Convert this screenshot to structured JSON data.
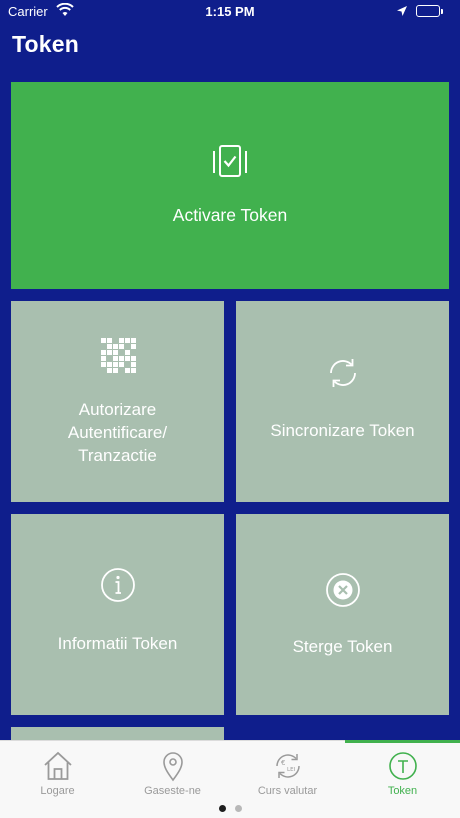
{
  "status_bar": {
    "carrier": "Carrier",
    "time": "1:15 PM",
    "battery_color": "#4cd964"
  },
  "page": {
    "title": "Token",
    "background": "#0f1e8c"
  },
  "tiles": {
    "activate": {
      "label": "Activare Token",
      "icon": "token-check-icon",
      "color": "#41b14e"
    },
    "authorize": {
      "line1": "Autorizare",
      "line2": "Autentificare/",
      "line3": "Tranzactie",
      "icon": "grid-pattern-icon",
      "color": "#a9bfaf"
    },
    "sync": {
      "label": "Sincronizare Token",
      "icon": "sync-icon",
      "color": "#a9bfaf"
    },
    "info": {
      "label": "Informatii Token",
      "icon": "info-icon",
      "color": "#a9bfaf"
    },
    "delete": {
      "label": "Sterge Token",
      "icon": "delete-icon",
      "color": "#a9bfaf"
    }
  },
  "tab_bar": {
    "tabs": [
      {
        "label": "Logare",
        "icon": "home-icon",
        "active": false
      },
      {
        "label": "Gaseste-ne",
        "icon": "location-pin-icon",
        "active": false
      },
      {
        "label": "Curs valutar",
        "icon": "currency-exchange-icon",
        "active": false
      },
      {
        "label": "Token",
        "icon": "token-icon",
        "active": true
      }
    ],
    "active_color": "#41b14e",
    "inactive_color": "#9a9a9a",
    "page_dots": {
      "count": 2,
      "current": 1
    }
  }
}
